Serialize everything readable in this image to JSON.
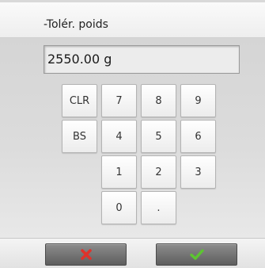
{
  "title": "-Tolér. poids",
  "display": {
    "value": "2550.00 g"
  },
  "keypad": {
    "clr": "CLR",
    "bs": "BS",
    "dot": ".",
    "digits": {
      "d0": "0",
      "d1": "1",
      "d2": "2",
      "d3": "3",
      "d4": "4",
      "d5": "5",
      "d6": "6",
      "d7": "7",
      "d8": "8",
      "d9": "9"
    }
  },
  "actions": {
    "cancel_icon": "red-x-icon",
    "confirm_icon": "green-check-icon"
  },
  "colors": {
    "cancel": "#e0322b",
    "confirm": "#5cc531",
    "action_button": "#6e6e6e"
  }
}
